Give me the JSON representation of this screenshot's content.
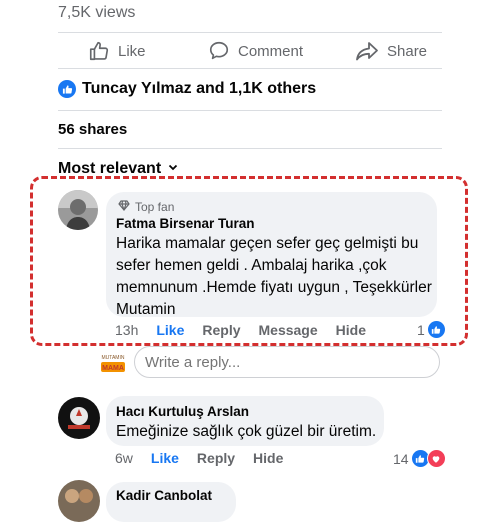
{
  "post": {
    "views": "7,5K views",
    "actions": {
      "like": "Like",
      "comment": "Comment",
      "share": "Share"
    },
    "likers": "Tuncay Yılmaz and 1,1K others",
    "shares": "56 shares",
    "sort_label": "Most relevant"
  },
  "comments": [
    {
      "badge": "Top fan",
      "author": "Fatma Birsenar Turan",
      "lines": [
        "Harika mamalar geçen sefer geç gelmişti bu",
        "sefer hemen geldi . Ambalaj harika ,çok",
        "memnunum .Hemde fiyatı uygun , Teşekkürler",
        "Mutamin"
      ],
      "time": "13h",
      "like": "Like",
      "reply": "Reply",
      "message": "Message",
      "hide": "Hide",
      "reactions": "1"
    },
    {
      "author": "Hacı Kurtuluş Arslan",
      "text": "Emeğinize sağlık çok güzel bir üretim.",
      "time": "6w",
      "like": "Like",
      "reply": "Reply",
      "hide": "Hide",
      "reactions": "14"
    },
    {
      "author": "Kadir Canbolat"
    }
  ],
  "reply_box": {
    "placeholder": "Write a reply...",
    "logo_text_top": "MUTAMIN",
    "logo_text_bottom": "MAMA"
  },
  "colors": {
    "accent": "#1877f2",
    "love": "#f33e58",
    "highlight": "#d32f2f"
  }
}
